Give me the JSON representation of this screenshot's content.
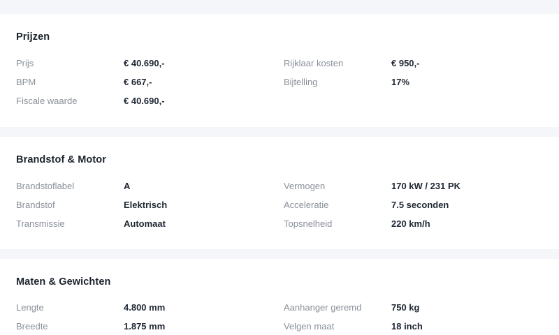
{
  "sections": [
    {
      "title": "Prijzen",
      "rows": [
        {
          "left": {
            "label": "Prijs",
            "value": "€ 40.690,-"
          },
          "right": {
            "label": "Rijklaar kosten",
            "value": "€ 950,-"
          }
        },
        {
          "left": {
            "label": "BPM",
            "value": "€ 667,-"
          },
          "right": {
            "label": "Bijtelling",
            "value": "17%"
          }
        },
        {
          "left": {
            "label": "Fiscale waarde",
            "value": "€ 40.690,-"
          },
          "right": {
            "label": "",
            "value": ""
          }
        }
      ]
    },
    {
      "title": "Brandstof & Motor",
      "rows": [
        {
          "left": {
            "label": "Brandstoflabel",
            "value": "A"
          },
          "right": {
            "label": "Vermogen",
            "value": "170 kW / 231 PK"
          }
        },
        {
          "left": {
            "label": "Brandstof",
            "value": "Elektrisch"
          },
          "right": {
            "label": "Acceleratie",
            "value": "7.5 seconden"
          }
        },
        {
          "left": {
            "label": "Transmissie",
            "value": "Automaat"
          },
          "right": {
            "label": "Topsnelheid",
            "value": "220 km/h"
          }
        }
      ]
    },
    {
      "title": "Maten & Gewichten",
      "rows": [
        {
          "left": {
            "label": "Lengte",
            "value": "4.800 mm"
          },
          "right": {
            "label": "Aanhanger geremd",
            "value": "750 kg"
          }
        },
        {
          "left": {
            "label": "Breedte",
            "value": "1.875 mm"
          },
          "right": {
            "label": "Velgen maat",
            "value": "18 inch"
          }
        }
      ]
    }
  ]
}
